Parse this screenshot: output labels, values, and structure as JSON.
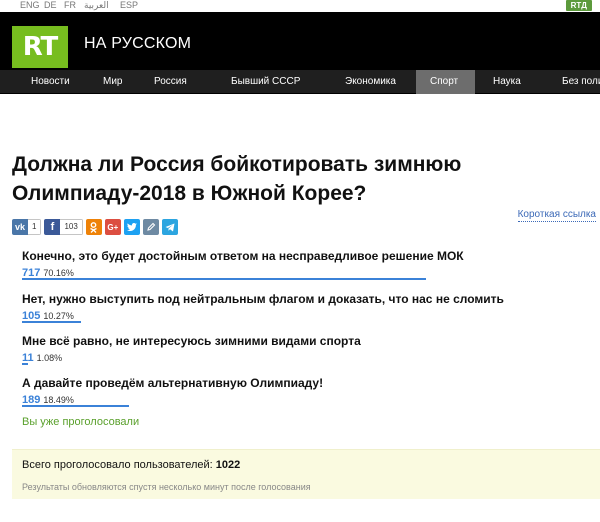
{
  "langs": [
    "ENG",
    "DE",
    "FR",
    "العربية",
    "ESP"
  ],
  "rtd_label": "RTД",
  "header": {
    "logo": "RT",
    "brand": "НА РУССКОМ"
  },
  "nav": {
    "items": [
      "Новости",
      "Мир",
      "Россия",
      "Бывший СССР",
      "Экономика",
      "Спорт",
      "Наука",
      "Без поли"
    ],
    "active": "Спорт"
  },
  "title": "Должна ли Россия бойкотировать зимнюю Олимпиаду-2018 в Южной Корее?",
  "share": {
    "vk_count": "1",
    "fb_count": "103",
    "colors": {
      "vk": "#4a76a8",
      "fb": "#3b5998",
      "ok": "#ee8208",
      "gplus": "#dc4e41",
      "twitter": "#1da1f2",
      "lj": "#6e8aa3",
      "telegram": "#2ca5e0"
    }
  },
  "short_link": "Короткая ссылка",
  "poll": {
    "options": [
      {
        "label": "Конечно, это будет достойным ответом на несправедливое решение МОК",
        "count": "717",
        "percent": "70.16%",
        "fraction": 0.7016
      },
      {
        "label": "Нет, нужно выступить под нейтральным флагом и доказать, что нас не сломить",
        "count": "105",
        "percent": "10.27%",
        "fraction": 0.1027
      },
      {
        "label": "Мне всё равно, не интересуюсь зимними видами спорта",
        "count": "11",
        "percent": "1.08%",
        "fraction": 0.0108
      },
      {
        "label": "А давайте проведём альтернативную Олимпиаду!",
        "count": "189",
        "percent": "18.49%",
        "fraction": 0.1849
      }
    ],
    "voted_text": "Вы уже проголосовали",
    "total_label": "Всего проголосовало пользователей:",
    "total_value": "1022",
    "note": "Результаты обновляются спустя несколько минут после голосования",
    "accent": "#3b82d8"
  }
}
